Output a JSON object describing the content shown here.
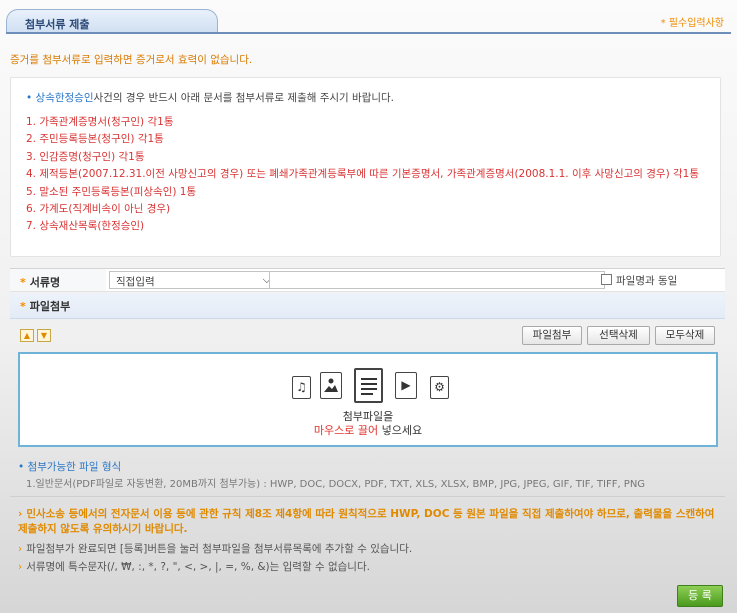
{
  "header": {
    "tab_title": "첨부서류 제출",
    "required_note": "* 필수입력사항"
  },
  "notice_top": "증거를 첨부서류로 입력하면 증거로서 효력이 없습니다.",
  "documents": {
    "intro_link": "상속한정승인",
    "intro_rest": "사건의 경우 반드시 아래 문서를 첨부서류로 제출해 주시기 바랍니다.",
    "items": [
      "1. 가족관계증명서(청구인) 각1통",
      "2. 주민등록등본(청구인) 각1통",
      "3. 인감증명(청구인) 각1통",
      "4. 제적등본(2007.12.31.이전 사망신고의 경우) 또는 폐쇄가족관계등록부에 따른 기본증명서, 가족관계증명서(2008.1.1. 이후 사망신고의 경우) 각1통",
      "5. 말소된 주민등록등본(피상속인) 1통",
      "6. 가계도(직계비속이 아닌 경우)",
      "7. 상속재산목록(한정승인)"
    ]
  },
  "form": {
    "doc_name_label": "서류명",
    "doc_select_value": "직접입력",
    "same_as_filename_label": "파일명과 동일",
    "file_attach_label": "파일첨부"
  },
  "buttons": {
    "attach": "파일첨부",
    "delete_selected": "선택삭제",
    "delete_all": "모두삭제",
    "register": "등 록"
  },
  "drop_zone": {
    "title": "첨부파일을",
    "hint_highlight": "마우스로 끌어",
    "hint_rest": " 넣으세요"
  },
  "file_types": {
    "title": "첨부가능한 파일 형식",
    "description": "1.일반문서(PDF파일로 자동변환, 20MB까지 첨부가능) : HWP, DOC, DOCX, PDF, TXT, XLS, XLSX, BMP, JPG, JPEG, GIF, TIF, TIFF, PNG"
  },
  "notes": [
    "민사소송 등에서의 전자문서 이용 등에 관한 규칙 제8조 제4항에 따라 원칙적으로 HWP, DOC 등 원본 파일을 직접 제출하여야 하므로, 출력물을 스캔하여 제출하지 않도록 유의하시기 바랍니다.",
    "파일첨부가 완료되면 [등록]버튼을 눌러 첨부파일을 첨부서류목록에 추가할 수 있습니다.",
    "서류명에 특수문자(/, ₩, :, *, ?, \", <, >, |, =, %, &)는 입력할 수 없습니다."
  ],
  "icons": [
    "audio-file-icon",
    "image-file-icon",
    "document-file-icon",
    "video-file-icon",
    "settings-file-icon"
  ],
  "colors": {
    "accent_orange": "#f08c00",
    "warning_red": "#d93434",
    "link_blue": "#2a77c8",
    "drop_border": "#6fb3d8",
    "register_green": "#5aa52a"
  }
}
